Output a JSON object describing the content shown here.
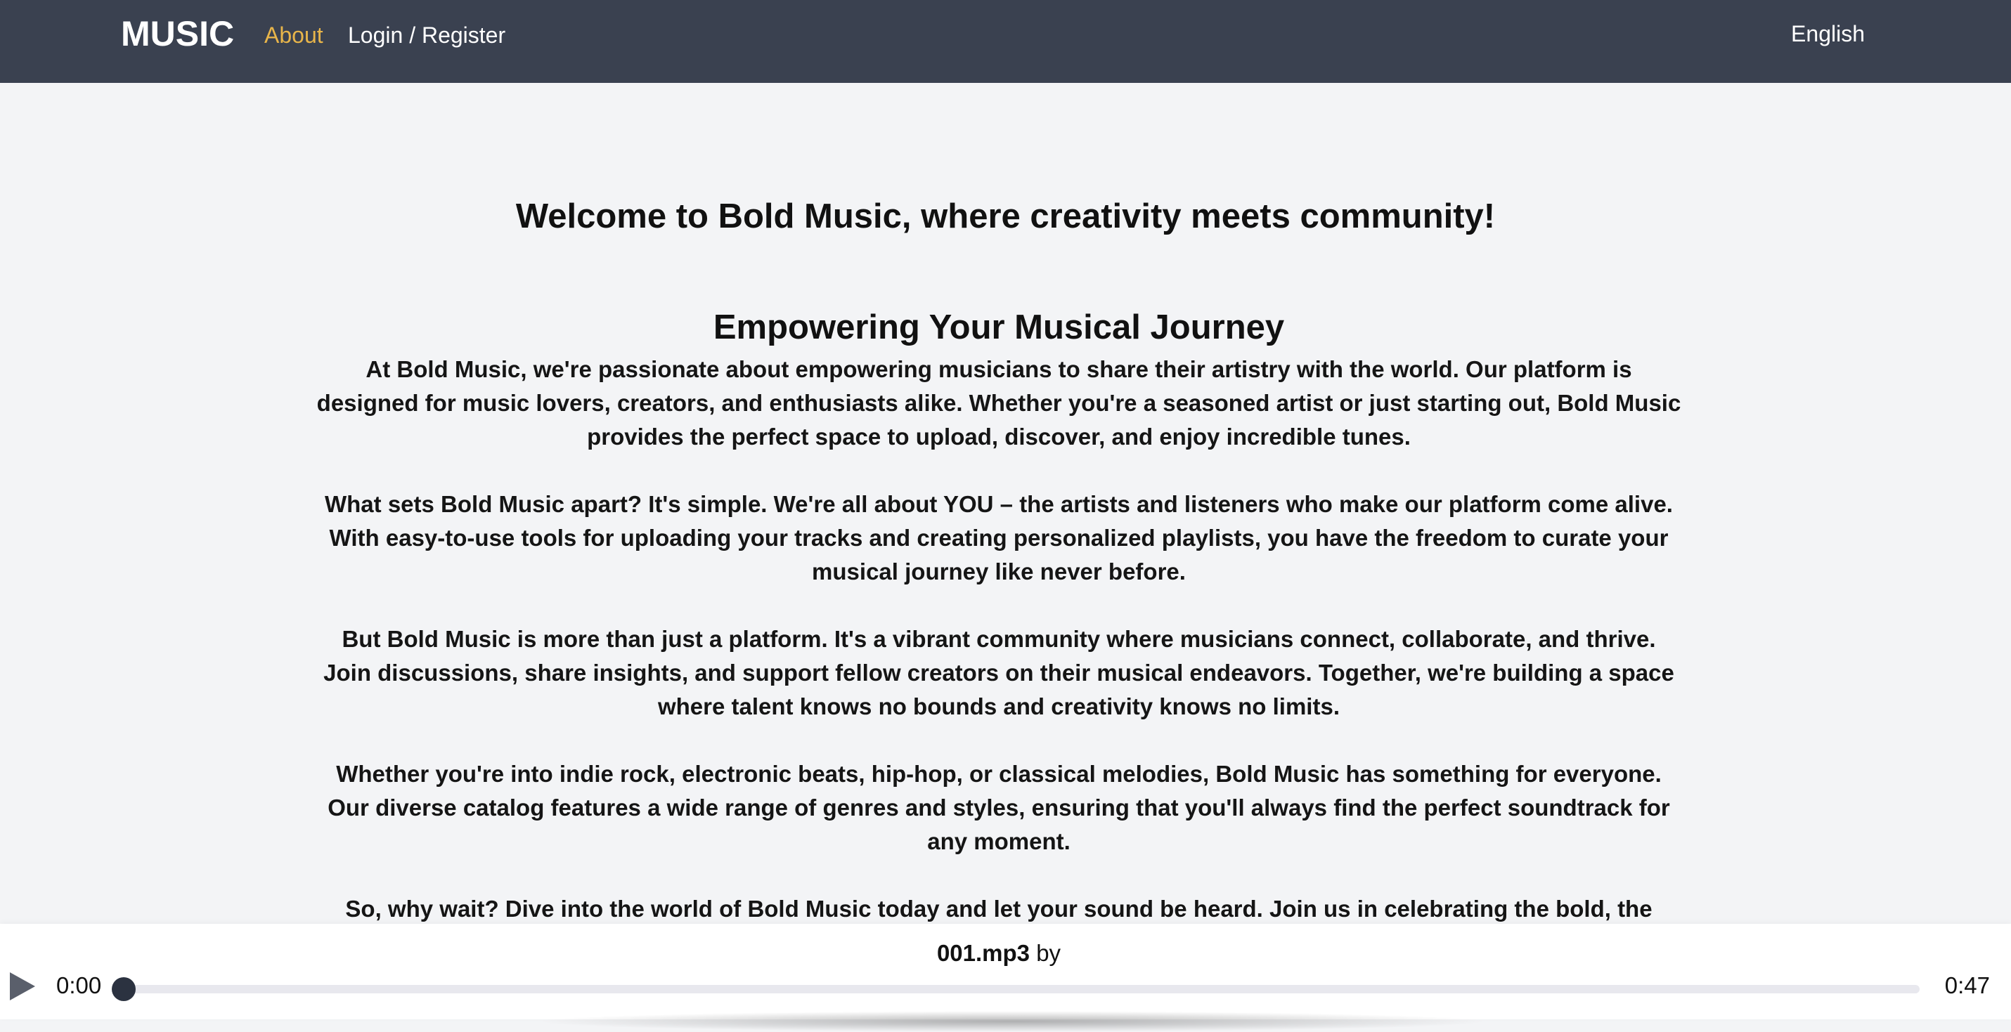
{
  "nav": {
    "brand": "MUSIC",
    "links": [
      "About",
      "Login / Register"
    ],
    "language": "English",
    "active_color": "#e8b54a",
    "background": "#3a4150"
  },
  "main": {
    "welcome_title": "Welcome to Bold Music, where creativity meets community!",
    "section_title": "Empowering Your Musical Journey",
    "paragraphs": [
      "At Bold Music, we're passionate about empowering musicians to share their artistry with the world. Our platform is designed for music lovers, creators, and enthusiasts alike. Whether you're a seasoned artist or just starting out, Bold Music provides the perfect space to upload, discover, and enjoy incredible tunes.",
      "What sets Bold Music apart? It's simple. We're all about YOU – the artists and listeners who make our platform come alive. With easy-to-use tools for uploading your tracks and creating personalized playlists, you have the freedom to curate your musical journey like never before.",
      "But Bold Music is more than just a platform. It's a vibrant community where musicians connect, collaborate, and thrive. Join discussions, share insights, and support fellow creators on their musical endeavors. Together, we're building a space where talent knows no bounds and creativity knows no limits.",
      "Whether you're into indie rock, electronic beats, hip-hop, or classical melodies, Bold Music has something for everyone. Our diverse catalog features a wide range of genres and styles, ensuring that you'll always find the perfect soundtrack for any moment.",
      "So, why wait? Dive into the world of Bold Music today and let your sound be heard. Join us in celebrating the bold, the"
    ]
  },
  "player": {
    "track_name": "001.mp3",
    "by_label": "by",
    "current_time": "0:00",
    "total_time": "0:47",
    "progress": 0,
    "play_icon": "play-icon"
  }
}
